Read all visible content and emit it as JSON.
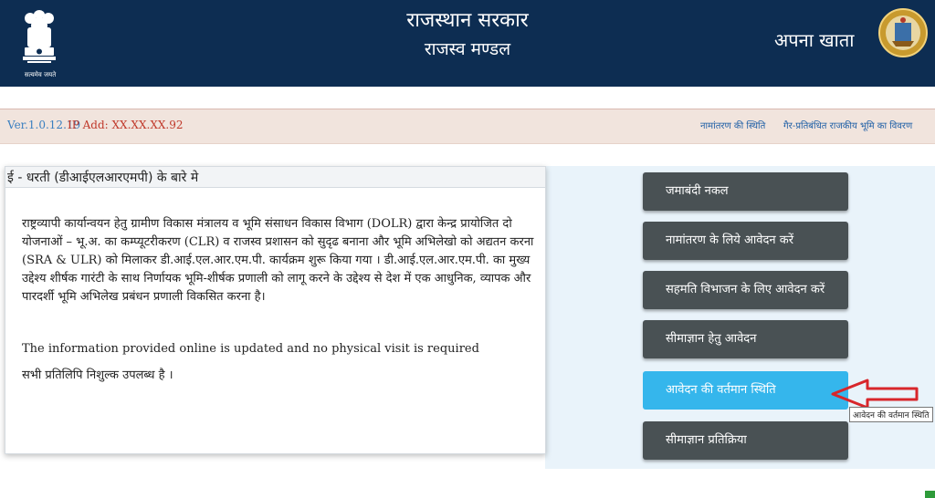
{
  "header": {
    "title": "राजस्थान सरकार",
    "subtitle": "राजस्व मण्डल",
    "right_title": "अपना खाता",
    "emblem_motto": "सत्यमेव जयते",
    "bg_color": "#0d2d52"
  },
  "infobar": {
    "version": "Ver.1.0.12.19",
    "ip": "IP Add: XX.XX.XX.92",
    "links": [
      "नामांतरण की स्थिति",
      "गैर-प्रतिबंधित राजकीय भूमि का विवरण"
    ]
  },
  "about": {
    "title": "ई - धरती (डीआईएलआरएमपी) के बारे मे",
    "paragraph": "राष्ट्रव्यापी कार्यान्वयन हेतु ग्रामीण विकास मंत्रालय व भूमि संसाधन विकास विभाग (DOLR) द्वारा केन्द्र प्रायोजित दो योजनाओं – भू.अ. का कम्प्यूटरीकरण (CLR) व राजस्व प्रशासन को सुदृढ बनाना और भूमि अभिलेखो को अद्यतन करना (SRA & ULR) को मिलाकर डी.आई.एल.आर.एम.पी. कार्यक्रम शुरू किया गया । डी.आई.एल.आर.एम.पी. का मुख्य उद्देश्य शीर्षक गारंटी के साथ निर्णायक भूमि-शीर्षक प्रणाली को लागू करने के उद्देश्य से देश में एक आधुनिक, व्यापक और पारदर्शी भूमि अभिलेख प्रबंधन प्रणाली विकसित करना है।",
    "english_note": "The information provided online is updated and no physical visit is required",
    "free_note": "सभी प्रतिलिपि निशुल्क उपलब्ध है ।"
  },
  "menu": {
    "buttons": [
      "जमाबंदी नकल",
      "नामांतरण के लिये आवेदन करें",
      "सहमति विभाजन के लिए आवेदन करें",
      "सीमाज्ञान हेतु आवेदन",
      "आवेदन की वर्तमान स्थिति",
      "सीमाज्ञान प्रतिक्रिया"
    ],
    "active_index": 4,
    "tooltip": "आवेदन की वर्तमान स्थिति",
    "button_color": "#495154",
    "active_color": "#35b6ec",
    "arrow_color": "#d8262b"
  }
}
